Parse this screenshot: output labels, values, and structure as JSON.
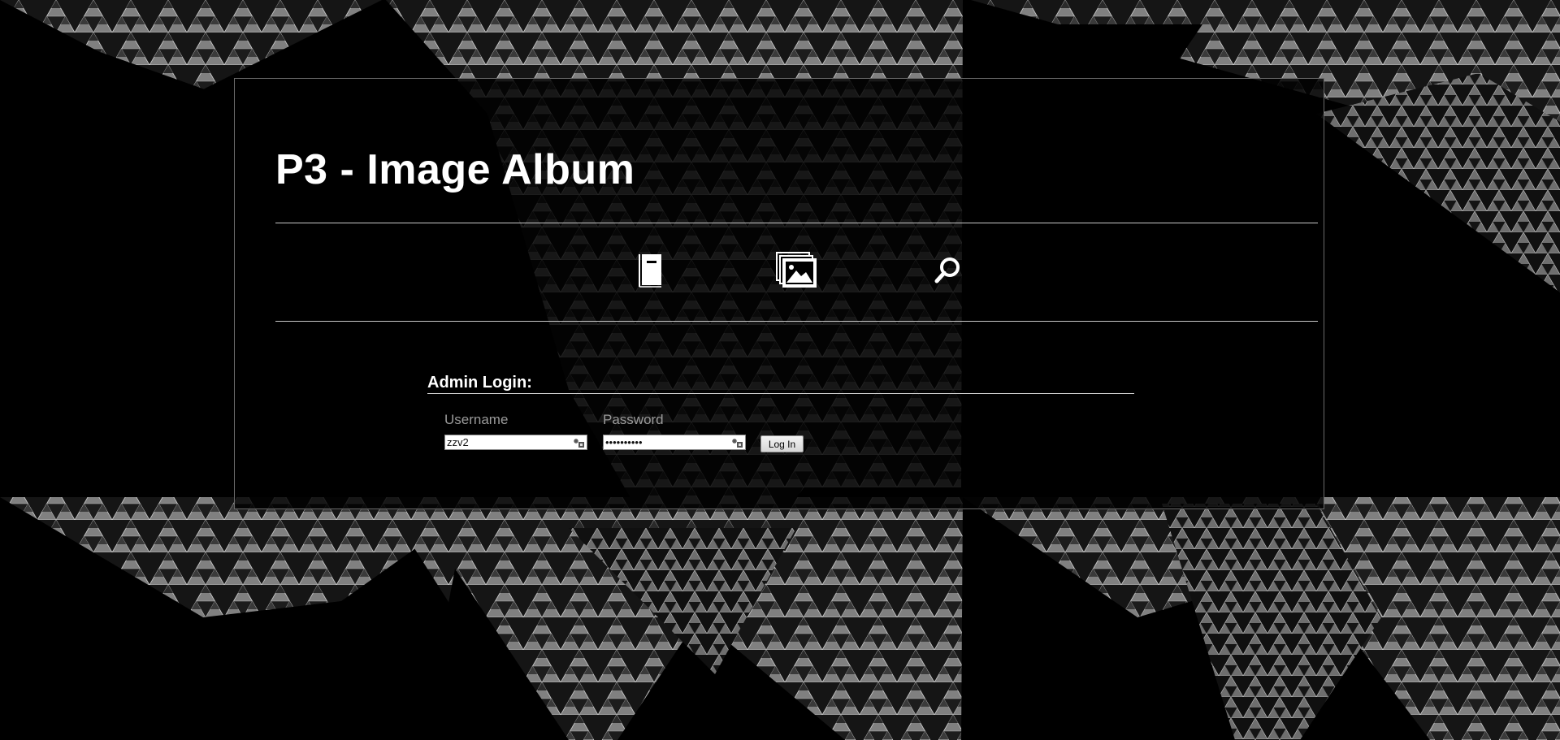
{
  "app": {
    "title": "P3 - Image Album"
  },
  "nav": {
    "items": [
      {
        "icon": "document-icon"
      },
      {
        "icon": "image-gallery-icon"
      },
      {
        "icon": "search-icon"
      }
    ]
  },
  "login": {
    "heading": "Admin Login:",
    "username_label": "Username",
    "username_value": "zzv2",
    "password_label": "Password",
    "password_value": "••••••••••",
    "submit_label": "Log In"
  },
  "colors": {
    "background": "#000000",
    "panel_border": "#6a6a6a",
    "text_primary": "#ffffff",
    "text_label": "#9a9a9a",
    "pattern": "#7a7a7a"
  }
}
